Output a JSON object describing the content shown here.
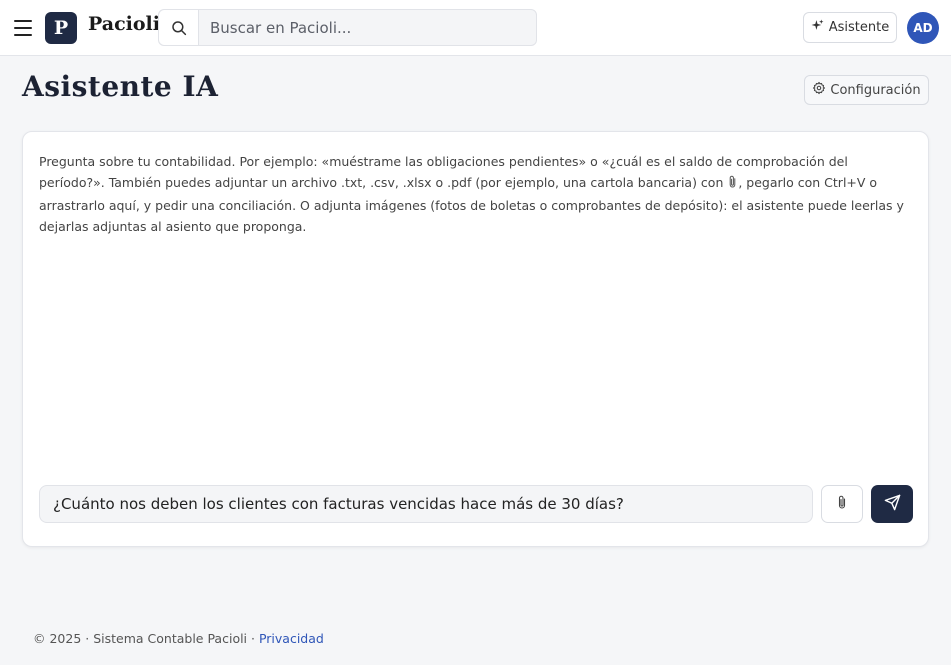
{
  "header": {
    "logo_letter": "P",
    "brand": "Pacioli",
    "search": {
      "placeholder": "Buscar en Pacioli..."
    },
    "assistant_button": "Asistente",
    "avatar_initials": "AD"
  },
  "page": {
    "title": "Asistente IA",
    "config_button": "Configuración"
  },
  "chat": {
    "intro_before_clip": "Pregunta sobre tu contabilidad. Por ejemplo: «muéstrame las obligaciones pendientes» o «¿cuál es el saldo de comprobación del período?». También puedes adjuntar un archivo .txt, .csv, .xlsx o .pdf (por ejemplo, una cartola bancaria) con",
    "intro_after_clip": ", pegarlo con Ctrl+V o arrastrarlo aquí, y pedir una conciliación. O adjunta imágenes (fotos de boletas o comprobantes de depósito): el asistente puede leerlas y dejarlas adjuntas al asiento que proponga.",
    "input_value": "¿Cuánto nos deben los clientes con facturas vencidas hace más de 30 días?"
  },
  "footer": {
    "text": "© 2025 · Sistema Contable Pacioli · ",
    "privacy_link": "Privacidad"
  },
  "colors": {
    "primary_dark": "#1f2a44",
    "accent_blue": "#2f56b8",
    "background": "#f5f6f8"
  },
  "icons": [
    "menu-icon",
    "search-icon",
    "sparkle-icon",
    "gear-icon",
    "paperclip-icon",
    "send-icon"
  ]
}
